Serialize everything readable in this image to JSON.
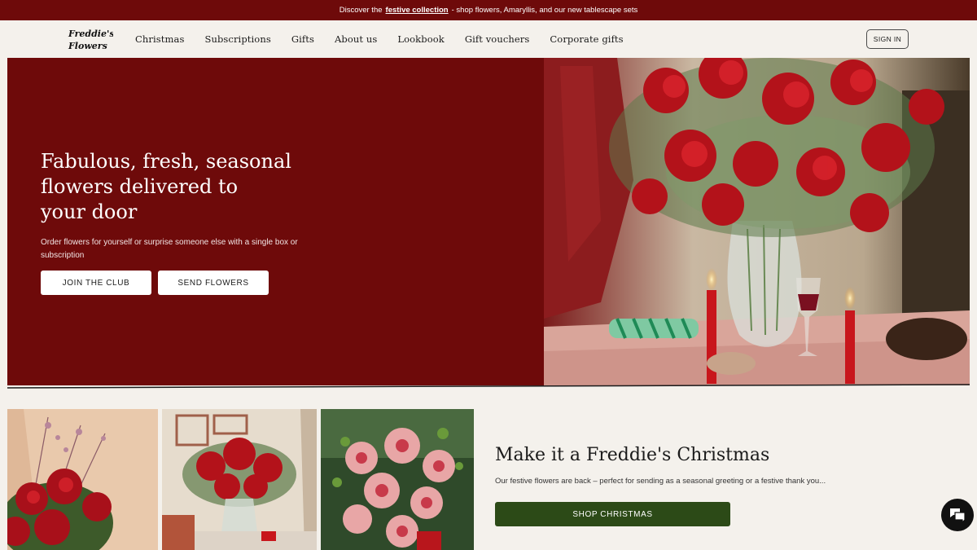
{
  "announcement": {
    "prefix": "Discover the",
    "link": "festive collection",
    "suffix": "- shop flowers, Amaryllis, and our new tablescape sets"
  },
  "nav": {
    "logo_text": "Freddie's Flowers",
    "items": [
      "Christmas",
      "Subscriptions",
      "Gifts",
      "About us",
      "Lookbook",
      "Gift vouchers",
      "Corporate gifts"
    ],
    "sign_in": "SIGN IN"
  },
  "hero": {
    "title_line1": "Fabulous, fresh, seasonal",
    "title_line2": "flowers delivered to",
    "title_line3": "your door",
    "subtitle": "Order flowers for yourself or surprise someone else with a single box or subscription",
    "btn_join": "JOIN THE CLUB",
    "btn_send": "SEND FLOWERS"
  },
  "feature": {
    "title": "Make it a Freddie's Christmas",
    "subtitle": "Our festive flowers are back – perfect for sending as a seasonal greeting or a festive thank you...",
    "button": "SHOP CHRISTMAS"
  },
  "colors": {
    "brand_red": "#6e0a0a",
    "cta_green": "#2c4a17",
    "background": "#f4f1ec"
  }
}
